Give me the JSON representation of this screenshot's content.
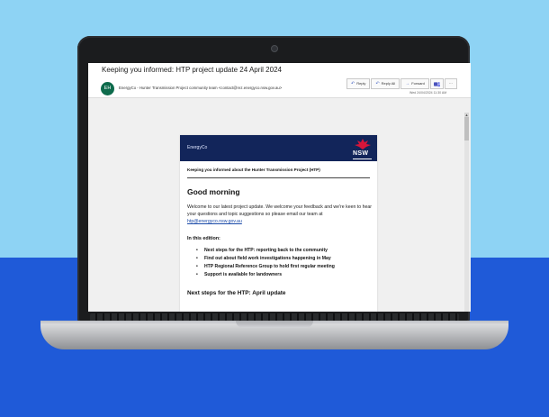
{
  "email": {
    "subject": "Keeping you informed: HTP project update 24 April 2024",
    "avatar_initials": "EH",
    "sender": "EnergyCo - Hunter Transmission Project community team <contact@rez.energyco.nsw.gov.au>",
    "date": "Wed 24/04/2024 11:30 AM",
    "actions": {
      "reply": "Reply",
      "reply_all": "Reply All",
      "forward": "Forward",
      "more": "···"
    }
  },
  "newsletter": {
    "brand": "EnergyCo",
    "gov_logo": "NSW",
    "intro": "Keeping you informed about the Hunter Transmission Project (HTP)",
    "greeting": "Good morning",
    "welcome_text": "Welcome to our latest project update. We welcome your feedback and we're keen to hear your questions and topic suggestions so please email our team at",
    "email_link": "htp@energyco.nsw.gov.au",
    "edition_heading": "In this edition:",
    "edition_items": [
      "Next steps for the HTP: reporting back to the community",
      "Find out about field work investigations happening in May",
      "HTP Regional Reference Group to hold first regular meeting",
      "Support is available for landowners"
    ],
    "next_heading": "Next steps for the HTP: April update"
  },
  "colors": {
    "banner": "#12255a",
    "avatar": "#0e6b4c",
    "waratah": "#d7153a",
    "background_top": "#8ed3f4",
    "background_bottom": "#1f5ad8"
  },
  "icons": {
    "reply": "reply-arrow-icon",
    "reply_all": "reply-all-icon",
    "forward": "forward-arrow-icon",
    "teams": "teams-icon",
    "logo": "waratah-icon"
  }
}
